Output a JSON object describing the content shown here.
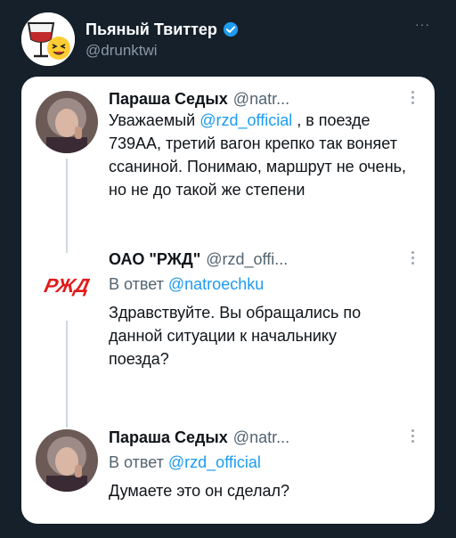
{
  "header": {
    "account_name": "Пьяный Твиттер",
    "account_handle": "@drunktwi",
    "more_label": "···"
  },
  "tweets": [
    {
      "name": "Параша Седых",
      "handle": "@natr...",
      "body_prefix": "Уважаемый ",
      "body_mention": "@rzd_official",
      "body_suffix": " , в поезде 739АА, третий вагон крепко так воняет ссаниной. Понимаю, маршрут не очень, но не до такой же степени"
    },
    {
      "name": "ОАО \"РЖД\"",
      "handle": "@rzd_offi...",
      "logo_text": "РЖД",
      "reply_prefix": "В ответ ",
      "reply_mention": "@natroechku",
      "body": "Здравствуйте. Вы обращались по данной ситуации к начальнику поезда?"
    },
    {
      "name": "Параша Седых",
      "handle": "@natr...",
      "reply_prefix": "В ответ ",
      "reply_mention": "@rzd_official",
      "body": "Думаете это он сделал?"
    }
  ],
  "colors": {
    "background": "#15202b",
    "card": "#ffffff",
    "mention": "#1d9bf0",
    "rzd_red": "#e21a1a",
    "verified": "#1d9bf0"
  }
}
